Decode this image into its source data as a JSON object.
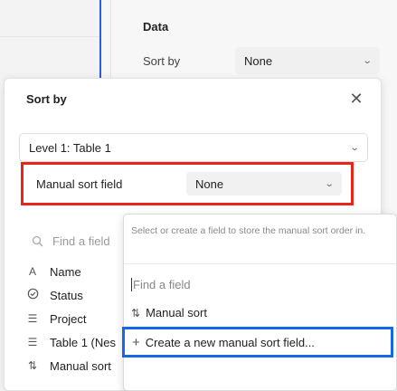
{
  "background": {
    "section_title": "Data",
    "sort_by_label": "Sort by",
    "sort_by_value": "None"
  },
  "dialog": {
    "title": "Sort by",
    "level_select": "Level 1: Table 1",
    "manual_sort_label": "Manual sort field",
    "manual_sort_value": "None",
    "search_placeholder": "Find a field",
    "fields": [
      {
        "icon": "text-icon",
        "label": "Name"
      },
      {
        "icon": "status-icon",
        "label": "Status"
      },
      {
        "icon": "lookup-icon",
        "label": "Project"
      },
      {
        "icon": "lookup-icon",
        "label": "Table 1 (Nes"
      },
      {
        "icon": "sort-icon",
        "label": "Manual sort"
      }
    ]
  },
  "dropdown": {
    "hint": "Select or create a field to store the manual sort order in.",
    "search_placeholder": "Find a field",
    "option": "Manual sort",
    "create_label": "Create a new manual sort field..."
  },
  "colors": {
    "highlight_red": "#e8251b",
    "highlight_blue": "#1368e8",
    "accent_line": "#2d5be3"
  }
}
